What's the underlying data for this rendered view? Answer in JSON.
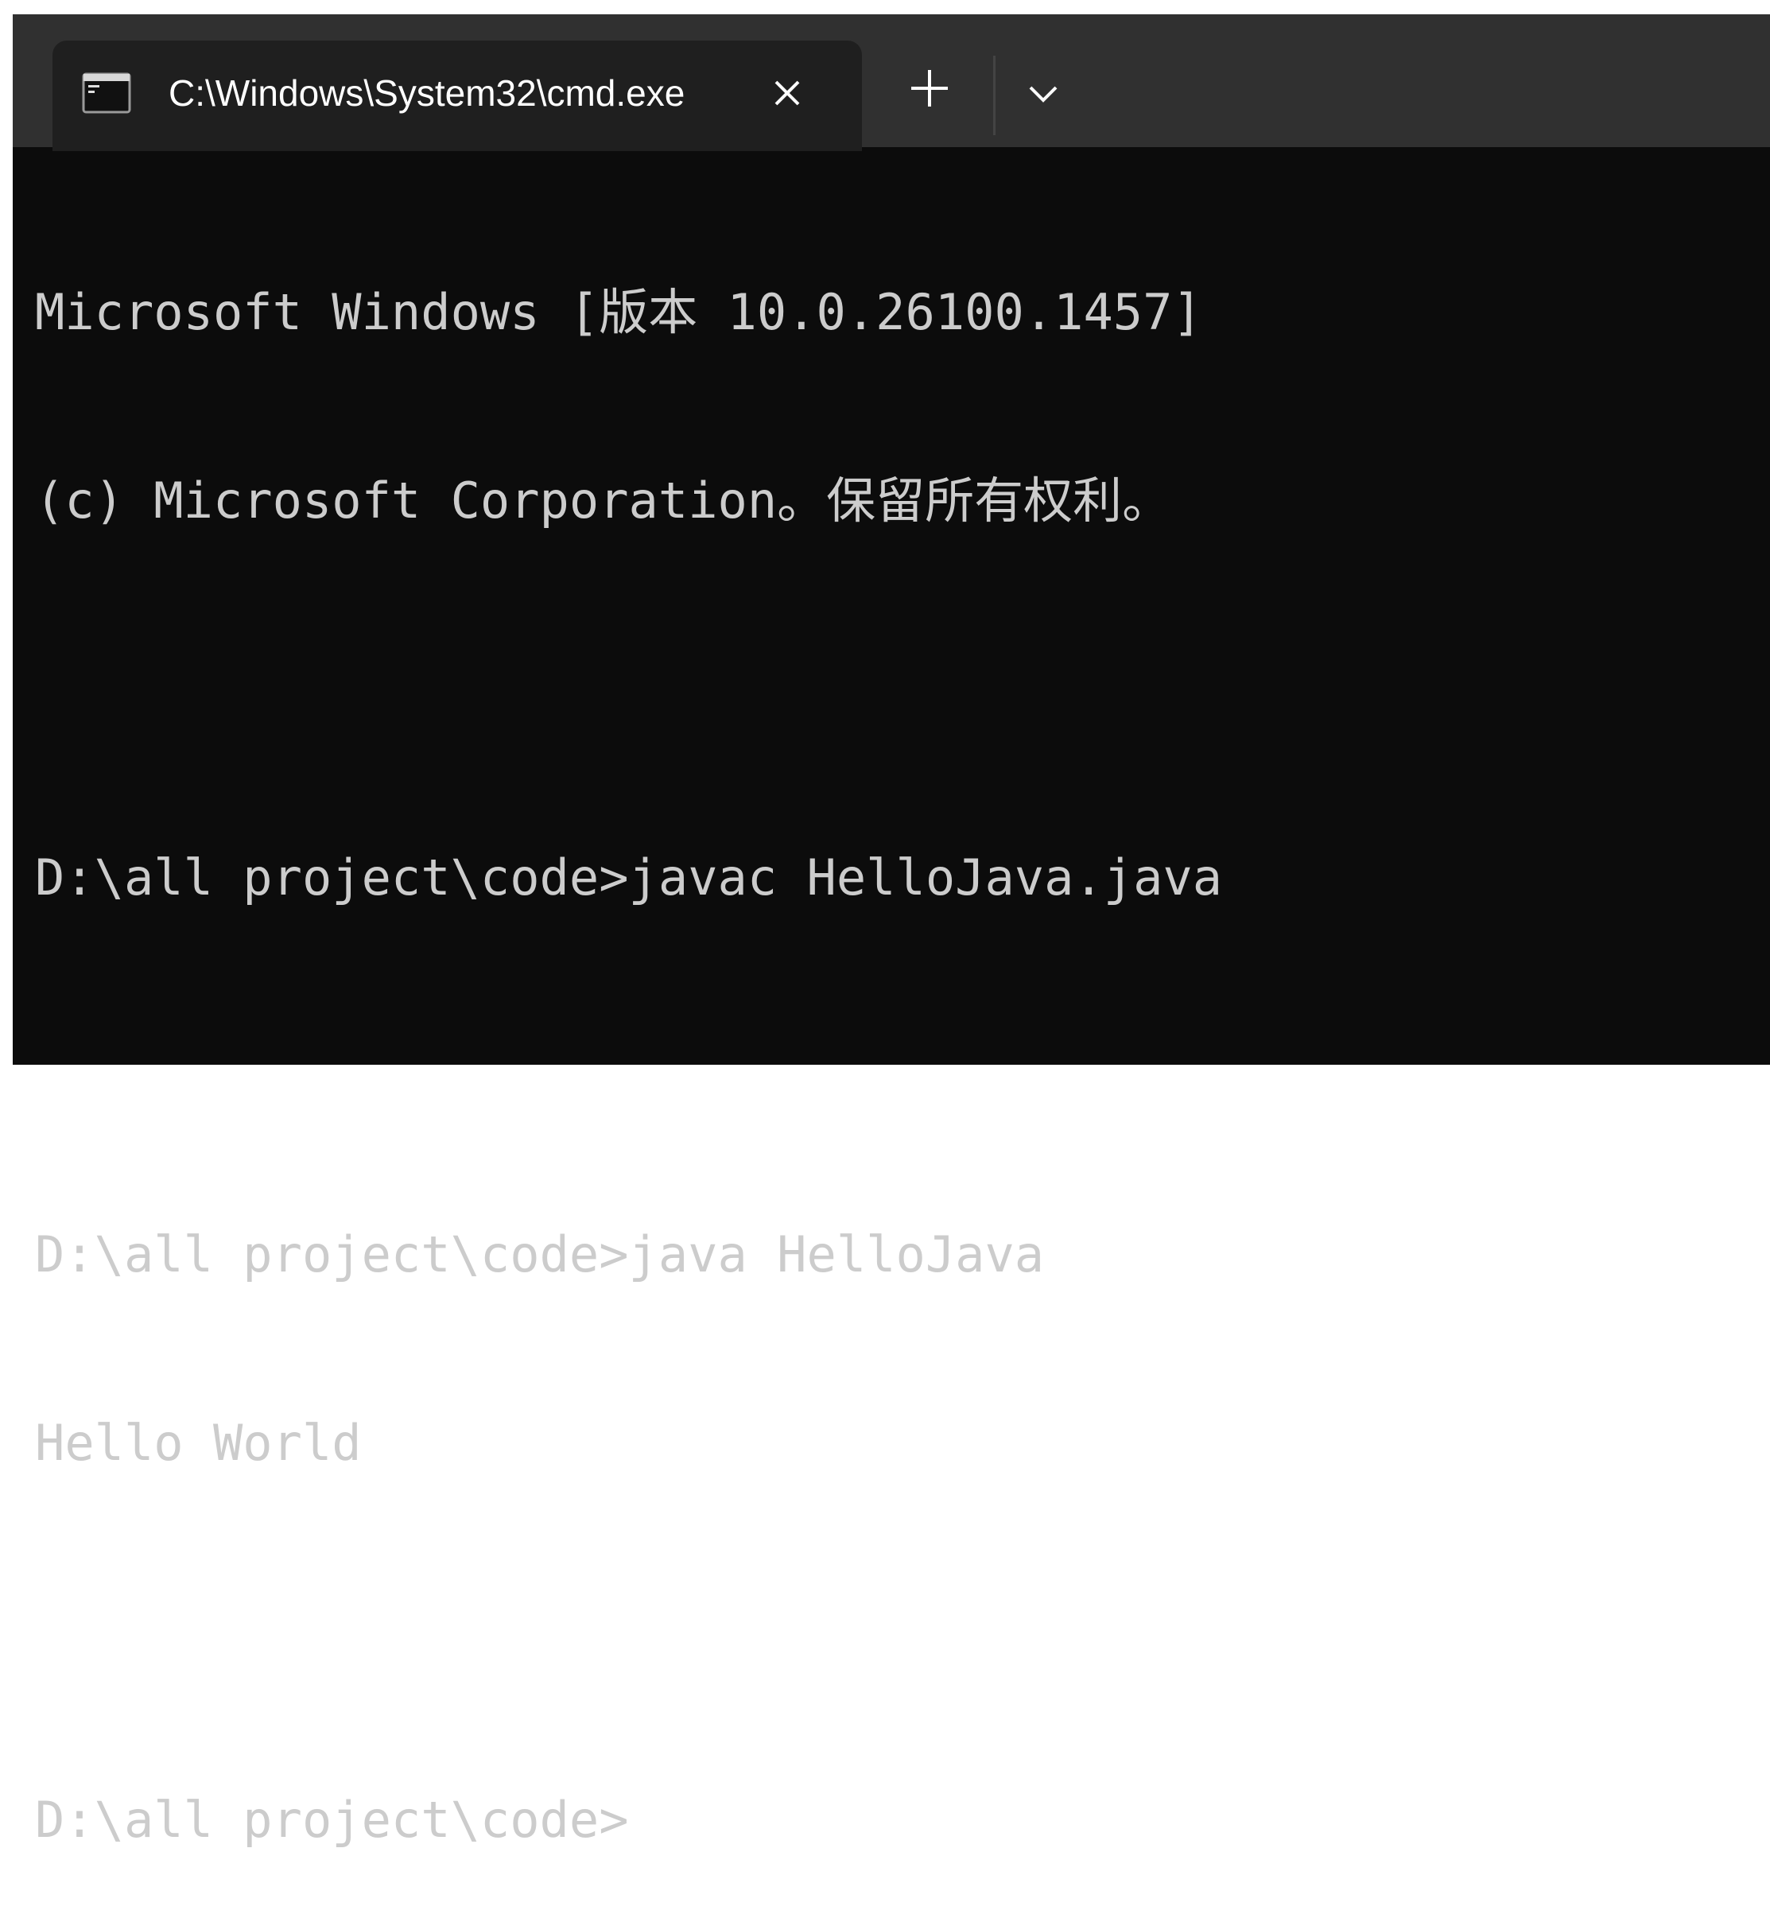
{
  "tab": {
    "title": "C:\\Windows\\System32\\cmd.exe",
    "icon": "terminal-icon",
    "close_icon": "close-icon"
  },
  "toolbar": {
    "new_tab_icon": "plus-icon",
    "dropdown_icon": "chevron-down-icon"
  },
  "console": {
    "lines": [
      "Microsoft Windows [版本 10.0.26100.1457]",
      "(c) Microsoft Corporation。保留所有权利。",
      "",
      "D:\\all project\\code>javac HelloJava.java",
      "",
      "D:\\all project\\code>java HelloJava",
      "Hello World",
      "",
      "D:\\all project\\code>"
    ]
  },
  "colors": {
    "tab_bar": "#303030",
    "active_tab": "#1f1f1f",
    "console_bg": "#0c0c0c",
    "console_text": "#cccccc"
  }
}
